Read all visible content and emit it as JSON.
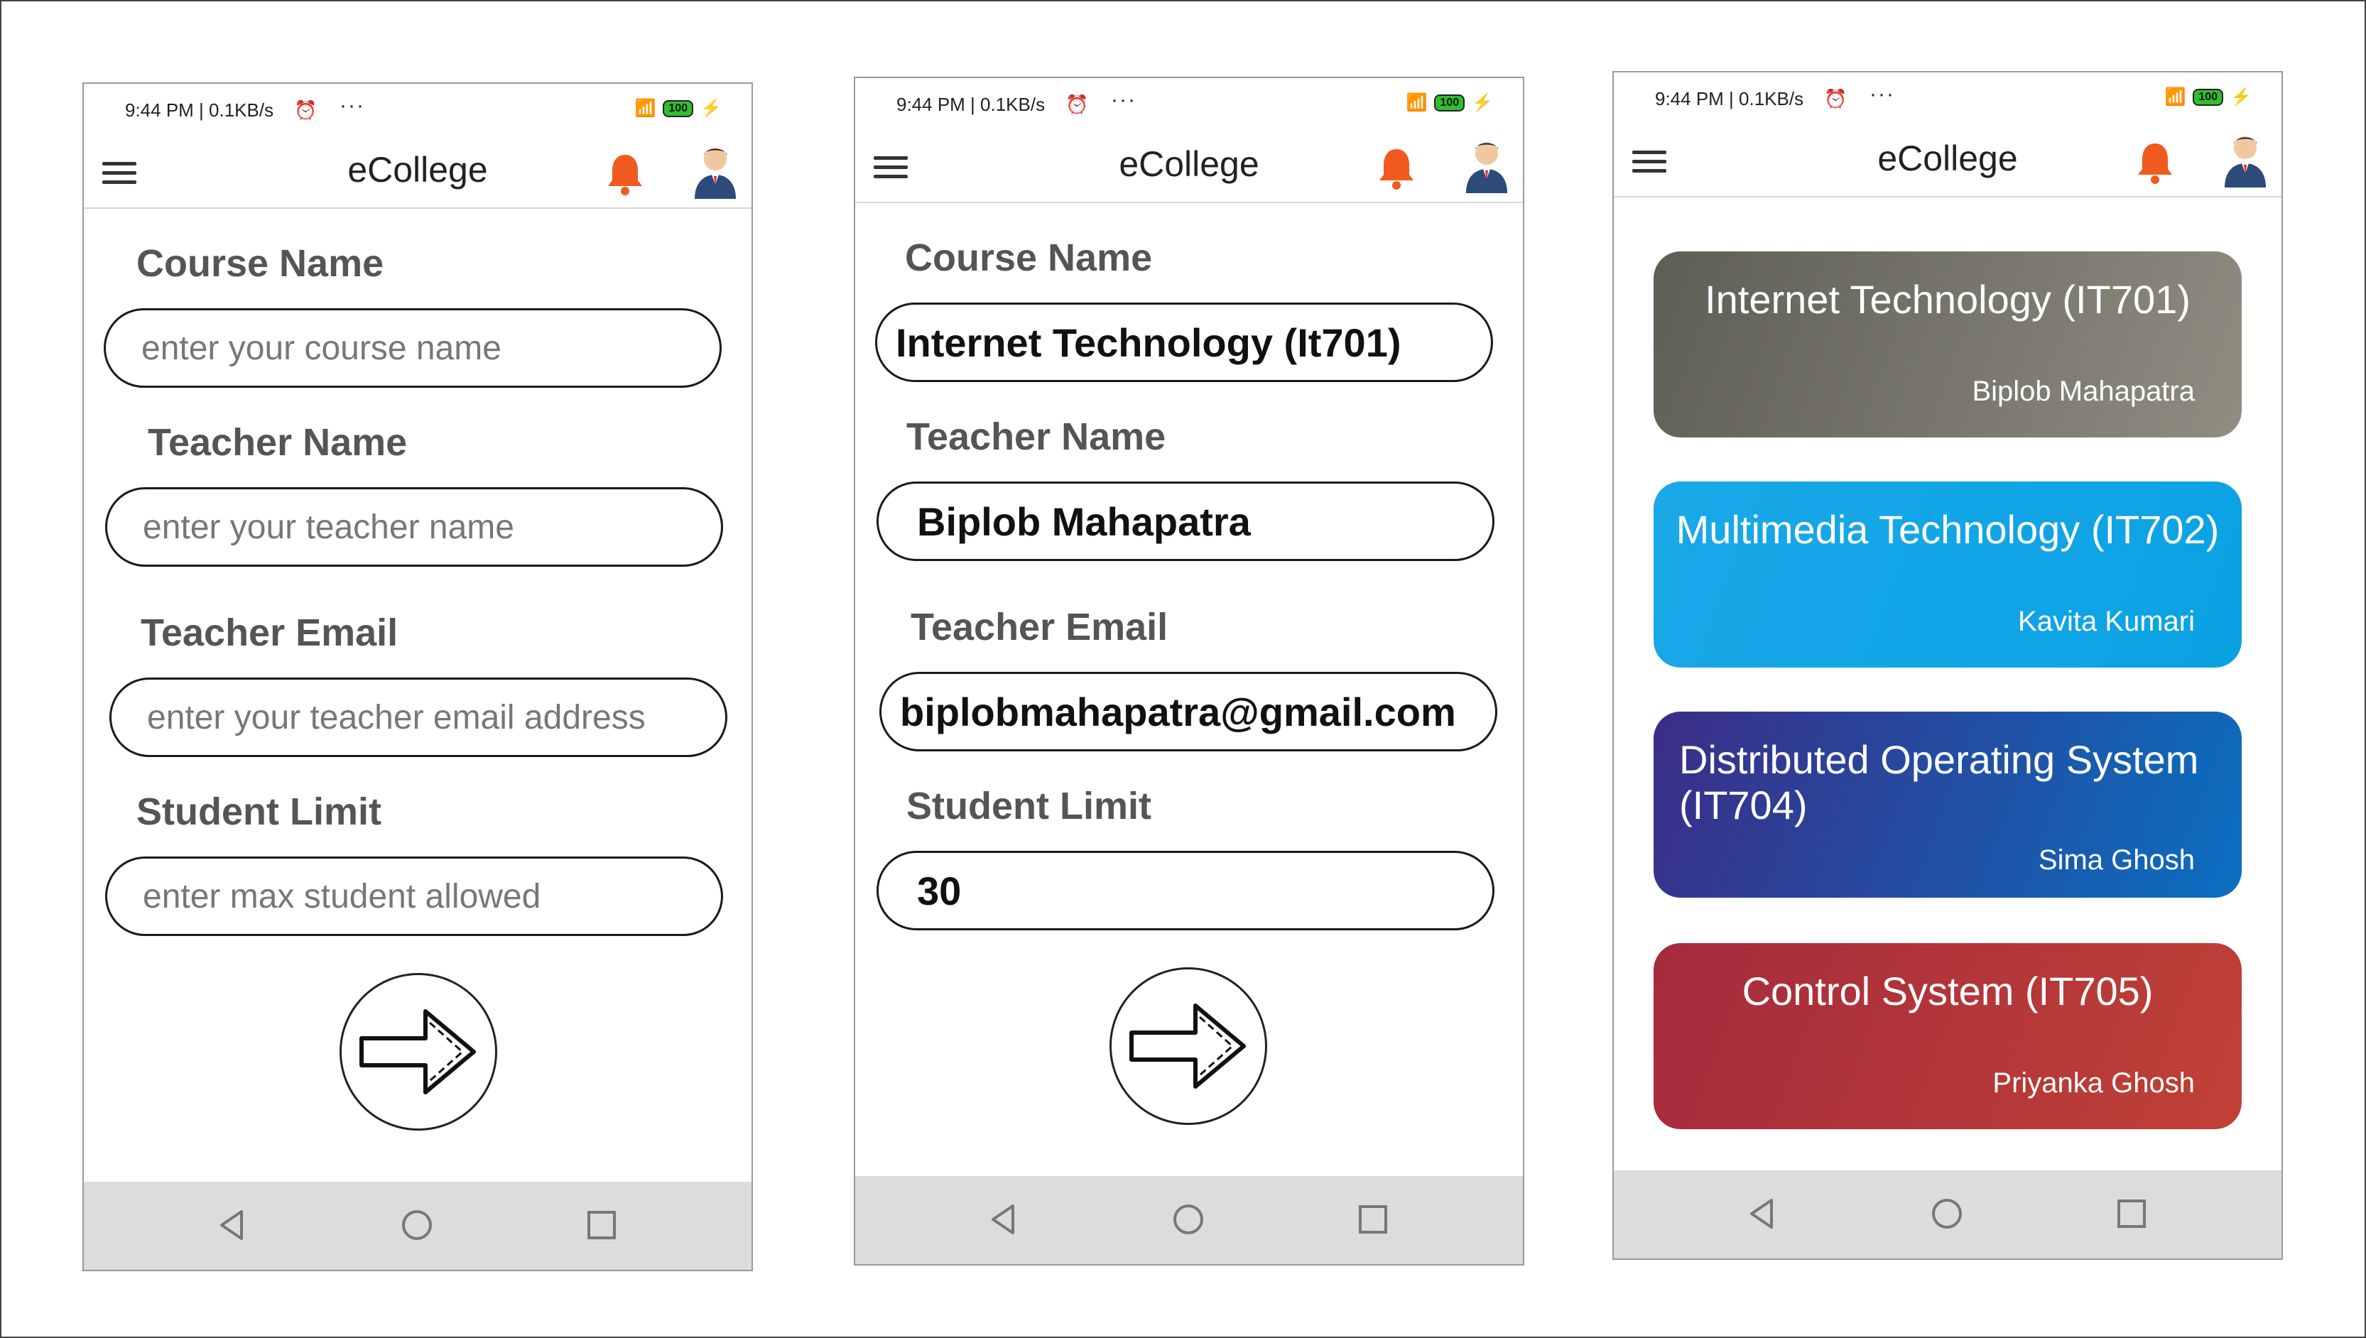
{
  "status_bar": {
    "time_speed": "9:44 PM | 0.1KB/s",
    "battery": "100"
  },
  "app": {
    "title": "eCollege"
  },
  "form": {
    "course_label": "Course Name",
    "course_placeholder": "enter your course name",
    "teacher_label": "Teacher Name",
    "teacher_placeholder": "enter your teacher name",
    "email_label": "Teacher Email",
    "email_placeholder": "enter your teacher email address",
    "limit_label": "Student Limit",
    "limit_placeholder": "enter max student allowed"
  },
  "filled_form": {
    "course_value": "Internet Technology (It701)",
    "teacher_value": "Biplob Mahapatra",
    "email_value": "biplobmahapatra@gmail.com",
    "limit_value": "30"
  },
  "courses": [
    {
      "title": "Internet Technology (IT701)",
      "teacher": "Biplob Mahapatra",
      "colors": [
        "#5f5e55",
        "#8f8d80"
      ]
    },
    {
      "title": "Multimedia Technology (IT702)",
      "teacher": "Kavita Kumari",
      "colors": [
        "#1aa8e8",
        "#0aa2e4"
      ]
    },
    {
      "title": "Distributed Operating System (IT704)",
      "teacher": "Sima Ghosh",
      "colors": [
        "#3b2d86",
        "#0a6fc0"
      ]
    },
    {
      "title": "Control System (IT705)",
      "teacher": "Priyanka Ghosh",
      "colors": [
        "#a52a3d",
        "#c04136"
      ]
    }
  ],
  "icons": [
    "menu-icon",
    "bell-icon",
    "avatar",
    "arrow-right-icon",
    "nav-back-icon",
    "nav-home-icon",
    "nav-recents-icon"
  ],
  "colors": {
    "bell": "#f15a1f",
    "navbar": "#dcdcdc"
  }
}
